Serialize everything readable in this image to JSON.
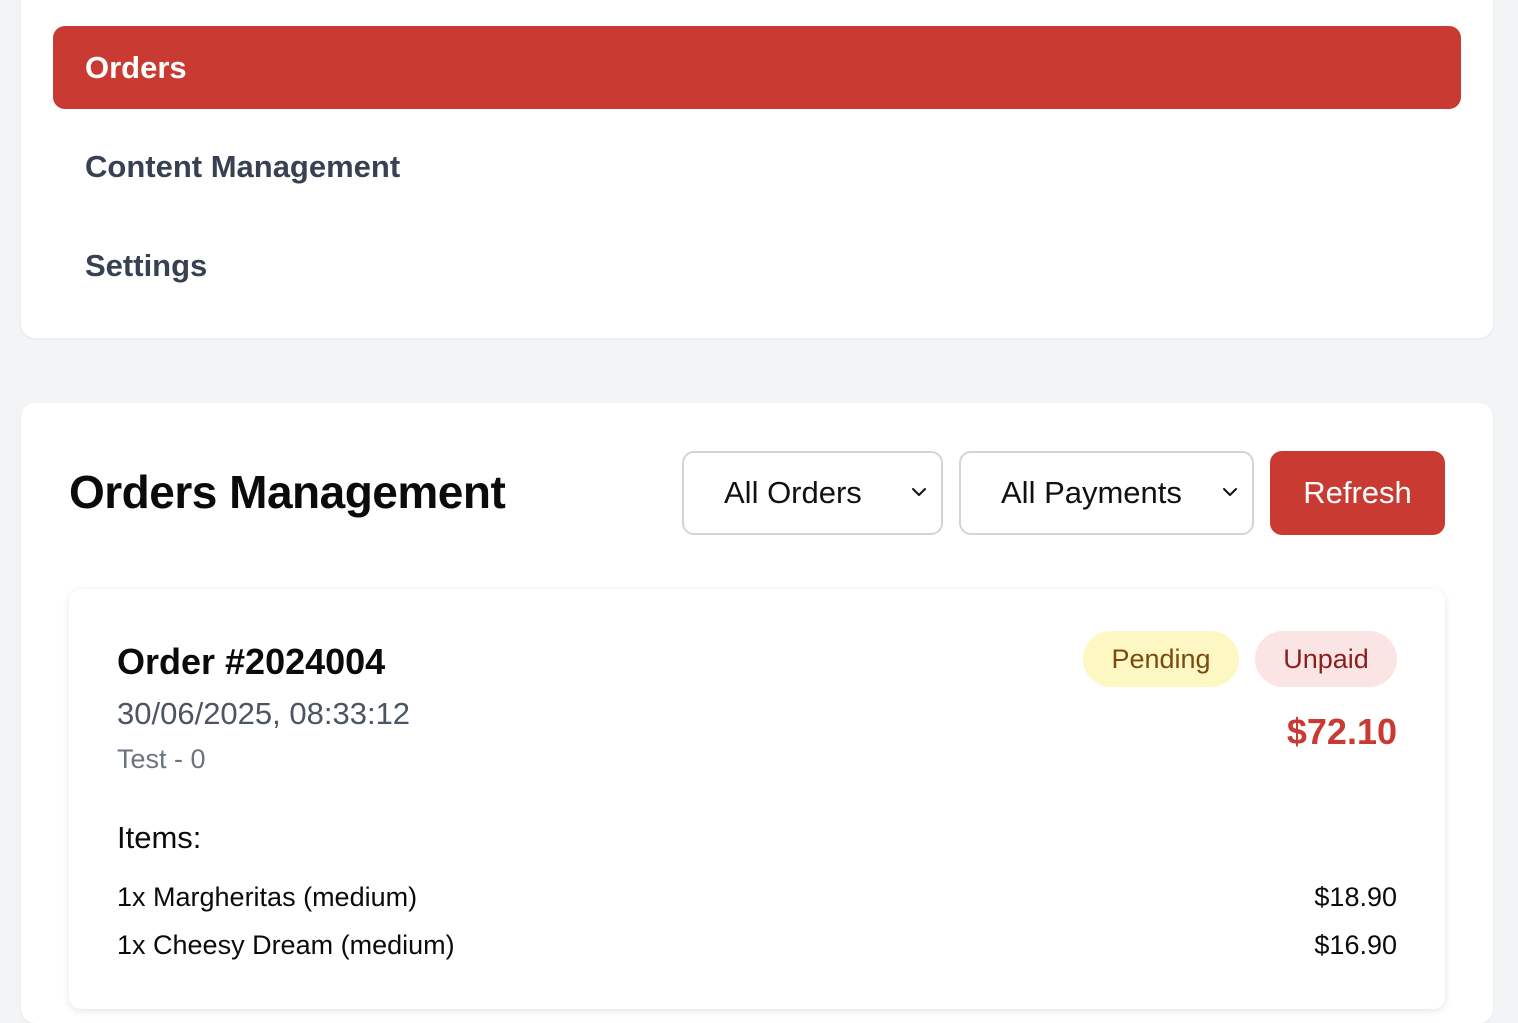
{
  "nav": {
    "items": [
      {
        "label": "Orders",
        "active": true
      },
      {
        "label": "Content Management",
        "active": false
      },
      {
        "label": "Settings",
        "active": false
      }
    ]
  },
  "orders": {
    "title": "Orders Management",
    "filters": {
      "status_selected": "All Orders",
      "payment_selected": "All Payments"
    },
    "refresh_label": "Refresh",
    "card": {
      "number": "Order #2024004",
      "date": "30/06/2025, 08:33:12",
      "customer": "Test - 0",
      "status_badge": "Pending",
      "payment_badge": "Unpaid",
      "total": "$72.10",
      "items_heading": "Items:",
      "items": [
        {
          "desc": "1x Margheritas (medium)",
          "price": "$18.90"
        },
        {
          "desc": "1x Cheesy Dream (medium)",
          "price": "$16.90"
        }
      ]
    }
  },
  "colors": {
    "accent": "#c93a32",
    "pending_bg": "#fdf8c3",
    "unpaid_bg": "#fbe4e4"
  },
  "icons": {
    "select_arrow": "chevron-down-icon"
  }
}
